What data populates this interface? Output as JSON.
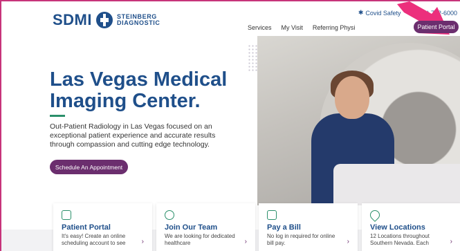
{
  "header": {
    "logo": {
      "brand": "SDMI",
      "line1": "STEINBERG",
      "line2": "DIAGNOSTIC"
    },
    "topbar": [
      {
        "icon": "shield-icon",
        "label": "Covid Safety"
      },
      {
        "icon": "phone-icon",
        "label": "(702) 732-6000"
      }
    ],
    "nav": [
      "Services",
      "My Visit",
      "Referring Physi"
    ],
    "portal_button": "Patient Portal"
  },
  "hero": {
    "title": "Las Vegas Medical Imaging Center.",
    "description": "Out-Patient Radiology in Las Vegas focused on an exceptional patient experience and accurate results through compassion and cutting edge technology.",
    "cta": "Schedule An Appointment"
  },
  "cards": [
    {
      "icon": "calendar-icon",
      "title": "Patient Portal",
      "text": "It's easy! Create an online scheduling account to see"
    },
    {
      "icon": "team-icon",
      "title": "Join Our Team",
      "text": "We are looking for dedicated healthcare"
    },
    {
      "icon": "bill-icon",
      "title": "Pay a Bill",
      "text": "No log in required for online bill pay."
    },
    {
      "icon": "location-icon",
      "title": "View Locations",
      "text": "12 Locations throughout Southern Nevada. Each"
    }
  ],
  "colors": {
    "brand_blue": "#1f4f8a",
    "accent_purple": "#6b2e6e",
    "annotation_pink": "#ec2f7c",
    "green": "#2a8f6a"
  }
}
